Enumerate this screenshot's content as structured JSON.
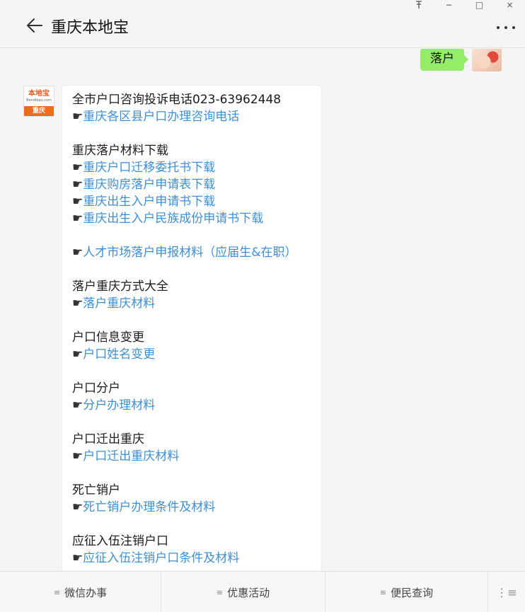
{
  "window": {
    "pin_icon": "pin-icon",
    "minimize_glyph": "−",
    "maximize_glyph": "□",
    "close_glyph": "×"
  },
  "header": {
    "title": "重庆本地宝"
  },
  "my_message": {
    "text": "落户"
  },
  "bot_avatar": {
    "logo_text": "本地宝",
    "logo_sub": "Bendibao.com",
    "city": "重庆"
  },
  "bot_message": {
    "pointer": "☛",
    "lines": [
      {
        "type": "plain",
        "text": "全市户口咨询投诉电话023-63962448"
      },
      {
        "type": "link",
        "text": "重庆各区县户口办理咨询电话"
      },
      {
        "type": "gap"
      },
      {
        "type": "plain",
        "text": "重庆落户材料下载"
      },
      {
        "type": "link",
        "text": "重庆户口迁移委托书下载"
      },
      {
        "type": "link",
        "text": "重庆购房落户申请表下载"
      },
      {
        "type": "link",
        "text": "重庆出生入户申请书下载"
      },
      {
        "type": "link",
        "text": "重庆出生入户民族成份申请书下载"
      },
      {
        "type": "gap"
      },
      {
        "type": "link",
        "text": "人才市场落户申报材料（应届生&在职）"
      },
      {
        "type": "gap"
      },
      {
        "type": "plain",
        "text": "落户重庆方式大全"
      },
      {
        "type": "link",
        "text": "落户重庆材料"
      },
      {
        "type": "gap"
      },
      {
        "type": "plain",
        "text": "户口信息变更"
      },
      {
        "type": "link",
        "text": "户口姓名变更"
      },
      {
        "type": "gap"
      },
      {
        "type": "plain",
        "text": "户口分户"
      },
      {
        "type": "link",
        "text": "分户办理材料"
      },
      {
        "type": "gap"
      },
      {
        "type": "plain",
        "text": "户口迁出重庆"
      },
      {
        "type": "link",
        "text": "户口迁出重庆材料"
      },
      {
        "type": "gap"
      },
      {
        "type": "plain",
        "text": "死亡销户"
      },
      {
        "type": "link",
        "text": "死亡销户办理条件及材料"
      },
      {
        "type": "gap"
      },
      {
        "type": "plain",
        "text": "应征入伍注销户口"
      },
      {
        "type": "link",
        "text": "应征入伍注销户口条件及材料"
      }
    ]
  },
  "bottom_menu": {
    "items": [
      {
        "label": "微信办事"
      },
      {
        "label": "优惠活动"
      },
      {
        "label": "便民查询"
      }
    ],
    "menu_glyph": "≡",
    "keyboard_glyph": "⋮≡"
  }
}
